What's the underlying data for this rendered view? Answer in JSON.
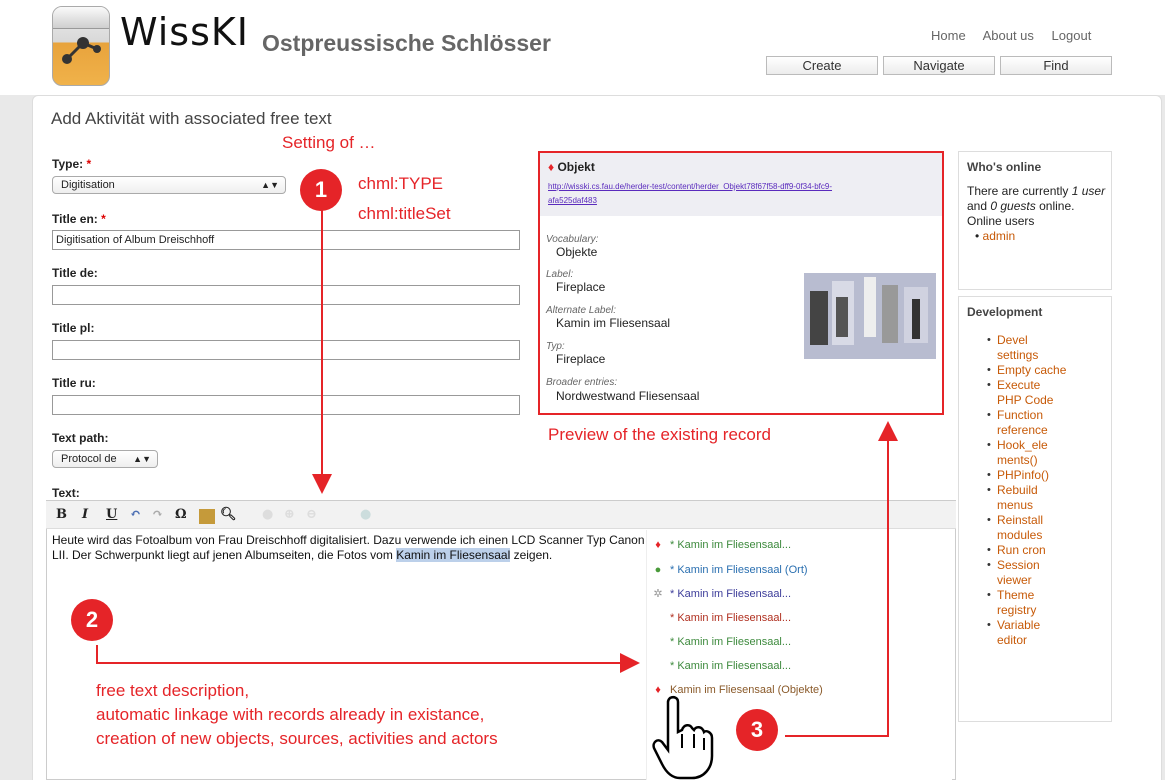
{
  "header": {
    "site_name": "WissKI",
    "slogan": "Ostpreussische Schlösser",
    "links": [
      "Home",
      "About us",
      "Logout"
    ],
    "buttons": [
      "Create",
      "Navigate",
      "Find"
    ]
  },
  "form": {
    "title": "Add Aktivität with associated free text",
    "type_label": "Type:",
    "type_value": "Digitisation",
    "title_en_label": "Title en:",
    "title_en_value": "Digitisation of Album Dreischhoff",
    "title_de_label": "Title de:",
    "title_pl_label": "Title pl:",
    "title_ru_label": "Title ru:",
    "text_path_label": "Text path:",
    "text_path_value": "Protocol de",
    "text_label": "Text:",
    "required_mark": "*"
  },
  "editor": {
    "text_before": "Heute wird das Fotoalbum von Frau Dreischhoff digitalisiert. Dazu verwende ich einen LCD Scanner Typ Canon LII. Der Schwerpunkt liegt auf jenen Albumseiten, die Fotos vom ",
    "highlight": "Kamin im Fliesensaal",
    "text_after": " zeigen.",
    "toolbar": [
      "B",
      "I",
      "U",
      "Ω"
    ]
  },
  "suggestions": [
    {
      "text": "* Kamin im Fliesensaal...",
      "color": "#3d8a3d",
      "icon": "gem-icon"
    },
    {
      "text": "* Kamin im Fliesensaal (Ort)",
      "color": "#2a6fb0",
      "icon": "globe-icon"
    },
    {
      "text": "* Kamin im Fliesensaal...",
      "color": "#3d3d9a",
      "icon": "gear-icon"
    },
    {
      "text": "* Kamin im Fliesensaal...",
      "color": "#b03020",
      "icon": ""
    },
    {
      "text": "* Kamin im Fliesensaal...",
      "color": "#3d8a3d",
      "icon": ""
    },
    {
      "text": "* Kamin im Fliesensaal...",
      "color": "#3d8a3d",
      "icon": ""
    },
    {
      "text": "Kamin im Fliesensaal (Objekte)",
      "color": "#8a5a2a",
      "icon": "gem-icon"
    }
  ],
  "preview": {
    "class": "Objekt",
    "url_line1": "http://wisski.cs.fau.de/herder-test/content/herder_Objekt78f67f58-dff9-0f34-bfc9-",
    "url_line2": "afa525daf483",
    "fields": [
      {
        "label": "Vocabulary:",
        "value": "Objekte"
      },
      {
        "label": "Label:",
        "value": "Fireplace"
      },
      {
        "label": "Alternate Label:",
        "value": "Kamin im Fliesensaal"
      },
      {
        "label": "Typ:",
        "value": "Fireplace"
      },
      {
        "label": "Broader entries:",
        "value": "Nordwestwand Fliesensaal"
      }
    ]
  },
  "sidebar": {
    "online_title": "Who's online",
    "online_text_1": "There are currently",
    "online_users_count": "1",
    "online_text_2": "user",
    "online_text_3": "and",
    "online_guests": "0 guests",
    "online_text_4": "online.",
    "online_users_label": "Online users",
    "online_user": "admin",
    "dev_title": "Development",
    "dev_items": [
      "Devel settings",
      "Empty cache",
      "Execute PHP Code",
      "Function reference",
      "Hook_elements()",
      "PHPinfo()",
      "Rebuild menus",
      "Reinstall modules",
      "Run cron",
      "Session viewer",
      "Theme registry",
      "Variable editor"
    ]
  },
  "annotations": {
    "setting_of": "Setting of …",
    "type_prop": "chml:TYPE",
    "title_prop": "chml:titleSet",
    "preview_caption": "Preview of the existing record",
    "free_text_1": "free text description,",
    "free_text_2": "automatic linkage with records already in existance,",
    "free_text_3": "creation of new objects, sources, activities and actors",
    "numbers": [
      "1",
      "2",
      "3"
    ],
    "accent": "#e52428"
  }
}
